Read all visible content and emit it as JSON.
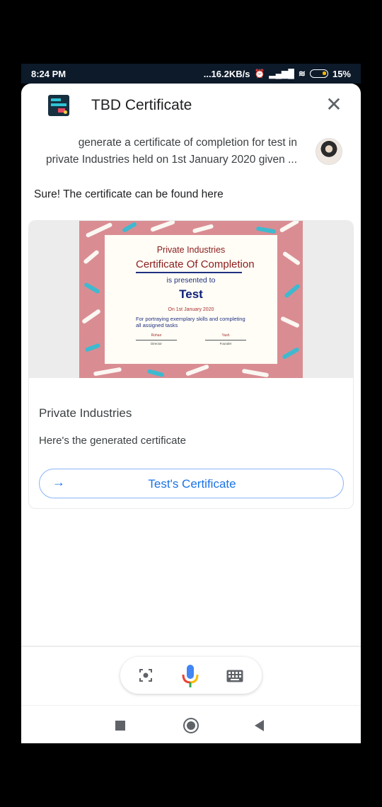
{
  "status_bar": {
    "time": "8:24 PM",
    "network_speed": "...16.2KB/s",
    "battery": "15%",
    "icons": [
      "alarm-icon",
      "signal-icon",
      "wifi-icon",
      "battery-icon"
    ]
  },
  "header": {
    "app_name": "TBD Certificate",
    "logo_icon": "app-logo-icon",
    "close_icon": "close-icon"
  },
  "conversation": {
    "user_query_line1": "generate a certificate of completion for test in",
    "user_query_line2": "private Industries held on 1st January 2020 given ...",
    "assistant_reply": "Sure! The certificate can be found here"
  },
  "card": {
    "certificate": {
      "company": "Private Industries",
      "heading": "Certificate Of Completion",
      "presented_to": "is presented to",
      "recipient": "Test",
      "date": "On 1st January 2020",
      "body": "For portraying exemplary skills and completing all assigned tasks",
      "signatory_1_name": "Rohan",
      "signatory_1_role": "Director",
      "signatory_2_name": "Yash",
      "signatory_2_role": "Founder"
    },
    "title": "Private Industries",
    "subtitle": "Here's the generated certificate",
    "button_label": "Test's Certificate"
  },
  "input_bar": {
    "icons": [
      "lens-icon",
      "mic-icon",
      "keyboard-icon"
    ]
  },
  "nav_bar": {
    "icons": [
      "recents-icon",
      "home-icon",
      "back-icon"
    ]
  },
  "colors": {
    "accent": "#1a73e8",
    "certificate_background": "#d98d92",
    "certificate_text": "#203080",
    "certificate_heading": "#8a1c1c"
  }
}
